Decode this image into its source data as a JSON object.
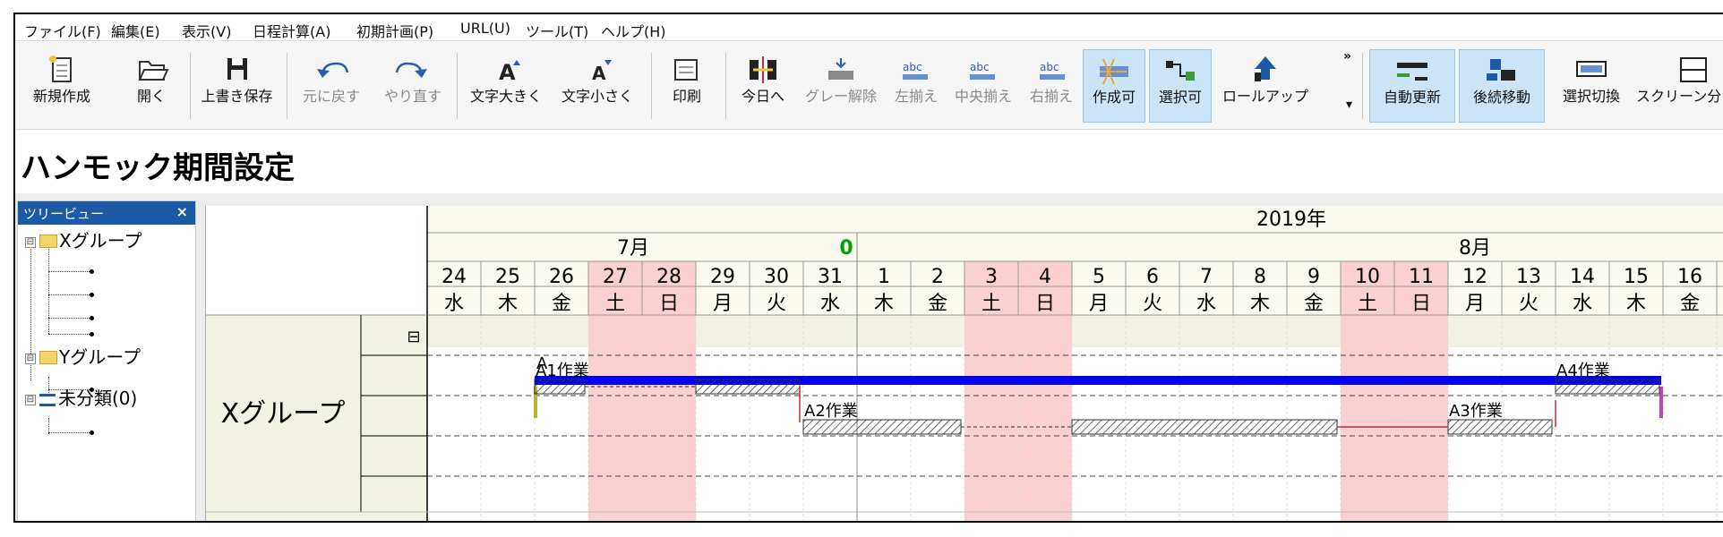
{
  "menu": [
    "ファイル(F)",
    "編集(E)",
    "表示(V)",
    "日程計算(A)",
    "初期計画(P)",
    "URL(U)",
    "ツール(T)",
    "ヘルプ(H)"
  ],
  "toolbar": {
    "new": "新規作成",
    "open": "開く",
    "save": "上書き保存",
    "undo": "元に戻す",
    "redo": "やり直す",
    "font_up": "文字大きく",
    "font_down": "文字小さく",
    "print": "印刷",
    "today": "今日へ",
    "gray_clear": "グレー解除",
    "align_left": "左揃え",
    "align_center": "中央揃え",
    "align_right": "右揃え",
    "creatable": "作成可",
    "selectable": "選択可",
    "rollup": "ロールアップ",
    "overflow": "»",
    "dropdown": "▾",
    "auto_update": "自動更新",
    "move_following": "後続移動",
    "toggle_select": "選択切換",
    "screen_split": "スクリーン分"
  },
  "page_title": "ハンモック期間設定",
  "tree": {
    "header": "ツリービュー",
    "close": "×",
    "group_x": "Xグループ",
    "group_y": "Yグループ",
    "uncategorized": "未分類(0)",
    "collapse": "⊟"
  },
  "gantt": {
    "year": "2019年",
    "months": [
      {
        "label": "7月"
      },
      {
        "label": "8月"
      }
    ],
    "today_marker": "0",
    "days": [
      "24",
      "25",
      "26",
      "27",
      "28",
      "29",
      "30",
      "31",
      "1",
      "2",
      "3",
      "4",
      "5",
      "6",
      "7",
      "8",
      "9",
      "10",
      "11",
      "12",
      "13",
      "14",
      "15",
      "16"
    ],
    "weekdays": [
      "水",
      "木",
      "金",
      "土",
      "日",
      "月",
      "火",
      "水",
      "木",
      "金",
      "土",
      "日",
      "月",
      "火",
      "水",
      "木",
      "金",
      "土",
      "日",
      "月",
      "火",
      "水",
      "木",
      "金"
    ],
    "weekend_flags": [
      0,
      0,
      0,
      1,
      1,
      0,
      0,
      0,
      0,
      0,
      1,
      1,
      0,
      0,
      0,
      0,
      0,
      1,
      1,
      0,
      0,
      0,
      0,
      0
    ],
    "group_label": "Xグループ",
    "collapse_icon": "⊟",
    "hammock_label": "A",
    "tasks": [
      "A1作業",
      "A2作業",
      "A3作業",
      "A4作業"
    ],
    "colors": {
      "hammock": "#0000ee",
      "weekend": "#fbd0d3",
      "start_marker": "#b5b52c",
      "end_marker": "#c040c0",
      "link": "#c03030",
      "today": "#00a000"
    }
  }
}
